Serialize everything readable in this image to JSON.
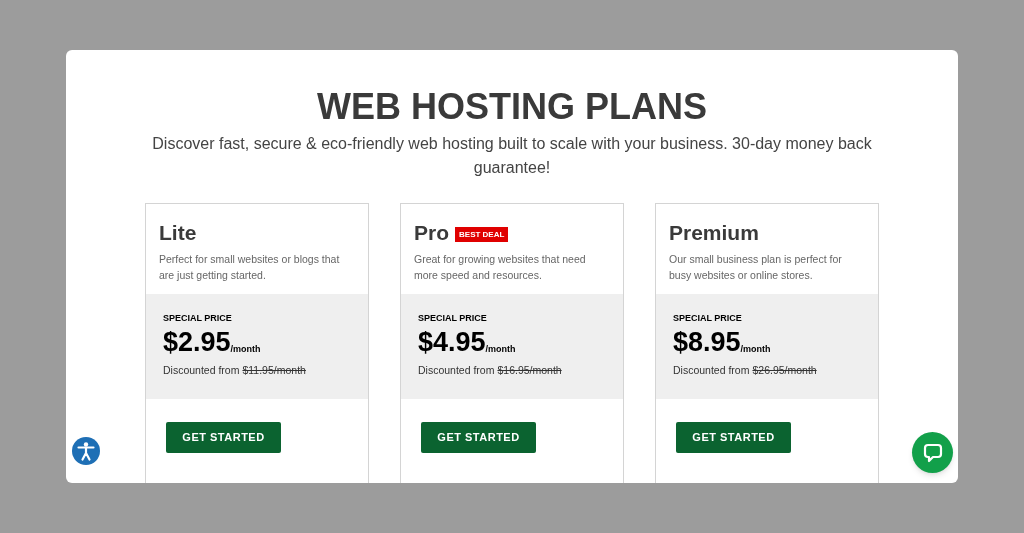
{
  "title": "WEB HOSTING PLANS",
  "subtitle": "Discover fast, secure & eco-friendly web hosting built to scale with your business. 30-day money back guarantee!",
  "plans": [
    {
      "name": "Lite",
      "description": "Perfect for small websites or blogs that are just getting started.",
      "price_label": "SPECIAL PRICE",
      "price": "$2.95",
      "period": "/month",
      "discount_label": "Discounted from",
      "old_price": "$11.95/month",
      "button": "GET STARTED"
    },
    {
      "name": "Pro",
      "badge": "BEST DEAL",
      "description": "Great for growing websites that need more speed and resources.",
      "price_label": "SPECIAL PRICE",
      "price": "$4.95",
      "period": "/month",
      "discount_label": "Discounted from",
      "old_price": "$16.95/month",
      "button": "GET STARTED"
    },
    {
      "name": "Premium",
      "description": "Our small business plan is perfect for busy websites or online stores.",
      "price_label": "SPECIAL PRICE",
      "price": "$8.95",
      "period": "/month",
      "discount_label": "Discounted from",
      "old_price": "$26.95/month",
      "button": "GET STARTED"
    }
  ]
}
